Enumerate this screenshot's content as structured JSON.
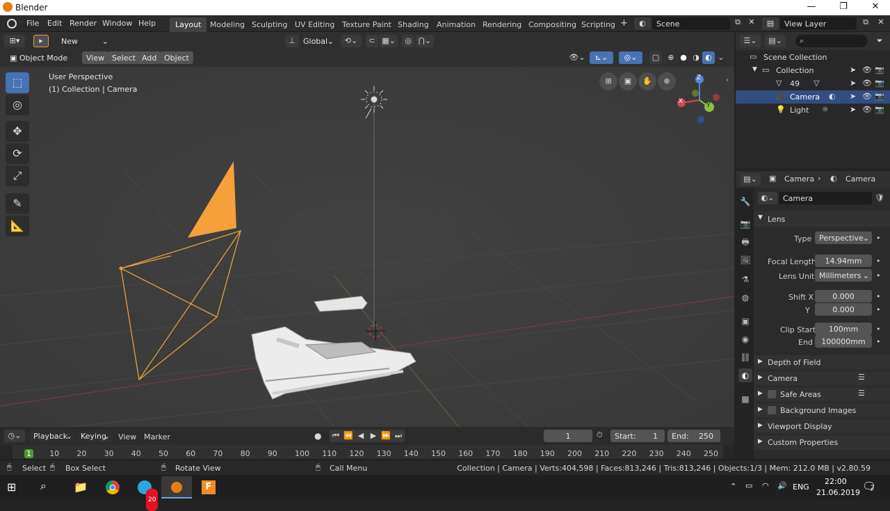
{
  "window": {
    "title": "Blender",
    "controls": [
      "—",
      "❐",
      "✕"
    ]
  },
  "menu": [
    "File",
    "Edit",
    "Render",
    "Window",
    "Help"
  ],
  "workspace_tabs": [
    "Layout",
    "Modeling",
    "Sculpting",
    "UV Editing",
    "Texture Paint",
    "Shading",
    "Animation",
    "Rendering",
    "Compositing",
    "Scripting"
  ],
  "active_tab": "Layout",
  "scene": {
    "value": "Scene"
  },
  "view_layer": {
    "value": "View Layer"
  },
  "header": {
    "new_label": "New",
    "transform": "Global"
  },
  "viewport_menu": {
    "mode": "Object Mode",
    "items": [
      "View",
      "Select",
      "Add",
      "Object"
    ]
  },
  "viewport": {
    "perspective": "User Perspective",
    "collection_info": "(1) Collection | Camera"
  },
  "gizmo": {
    "x": "X",
    "y": "Y",
    "z": "Z"
  },
  "outliner": {
    "root": "Scene Collection",
    "collection": "Collection",
    "items": [
      {
        "name": "49"
      },
      {
        "name": "Camera"
      },
      {
        "name": "Light"
      }
    ]
  },
  "properties": {
    "breadcrumb_1": "Camera",
    "breadcrumb_2": "Camera",
    "data_name": "Camera",
    "lens_panel": "Lens",
    "type_label": "Type",
    "type_value": "Perspective",
    "focal_label": "Focal Length",
    "focal_value": "14.94mm",
    "lens_unit_label": "Lens Unit",
    "lens_unit_value": "Millimeters",
    "shift_x_label": "Shift X",
    "shift_x_value": "0.000",
    "shift_y_label": "Y",
    "shift_y_value": "0.000",
    "clip_start_label": "Clip Start",
    "clip_start_value": "100mm",
    "clip_end_label": "End",
    "clip_end_value": "100000mm",
    "panels": [
      "Depth of Field",
      "Camera",
      "Safe Areas",
      "Background Images",
      "Viewport Display",
      "Custom Properties"
    ]
  },
  "timeline": {
    "menus": [
      "Playback",
      "Keying",
      "View",
      "Marker"
    ],
    "current_frame": "1",
    "start_label": "Start:",
    "start_value": "1",
    "end_label": "End:",
    "end_value": "250",
    "ticks": [
      "1",
      "10",
      "20",
      "30",
      "40",
      "50",
      "60",
      "70",
      "80",
      "90",
      "100",
      "110",
      "120",
      "130",
      "140",
      "150",
      "160",
      "170",
      "180",
      "190",
      "200",
      "210",
      "220",
      "230",
      "240",
      "250"
    ]
  },
  "statusbar": {
    "select": "Select",
    "box_select": "Box Select",
    "rotate_view": "Rotate View",
    "call_menu": "Call Menu",
    "stats": "Collection | Camera | Verts:404,598 | Faces:813,246 | Tris:813,246 | Objects:1/3 | Mem: 212.0 MB | v2.80.59"
  },
  "taskbar": {
    "lang": "ENG",
    "time": "22:00",
    "date": "21.06.2019",
    "badge": "20",
    "notif": "2"
  }
}
